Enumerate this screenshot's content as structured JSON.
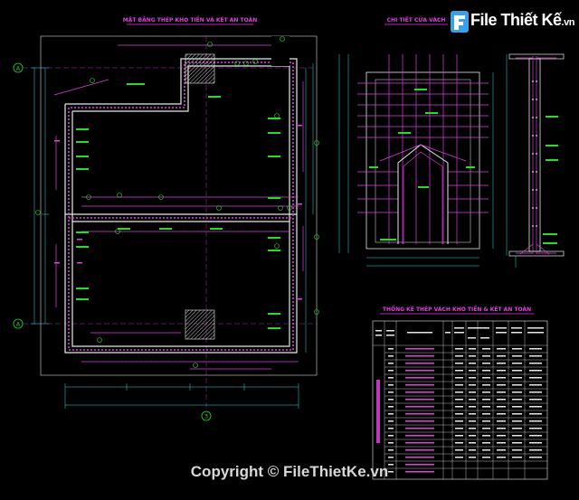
{
  "titles": {
    "plan_title": "MẶT BẰNG THÉP KHO TIỀN VÀ KÉT AN TOÀN",
    "door_detail_title": "CHI TIẾT CỬA VÁCH",
    "table_title": "THỐNG KÊ THÉP VÁCH KHO TIỀN & KÉT AN TOÀN"
  },
  "grid_bubbles": [
    "A",
    "A",
    "3"
  ],
  "logo": {
    "brand": "File Thiết Kế",
    "tld": ".vn"
  },
  "watermark": {
    "copyright": "Copyright © FileThietKe.vn"
  },
  "colors": {
    "background": "#000000",
    "rebar": "#e040e0",
    "dimension": "#20e0e0",
    "annotation": "#20e020",
    "hatch": "#c8c8c8"
  }
}
